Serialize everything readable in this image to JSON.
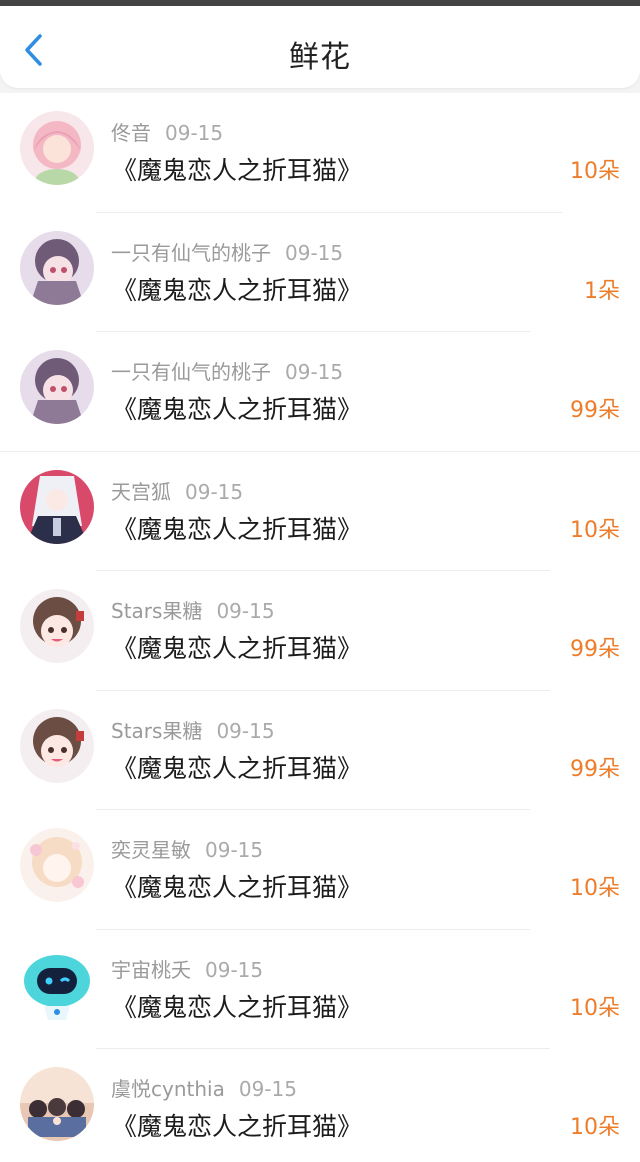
{
  "header": {
    "title": "鲜花"
  },
  "items": [
    {
      "name": "佟音",
      "date": "09-15",
      "book": "《魔鬼恋人之折耳猫》",
      "count": "10朵"
    },
    {
      "name": "一只有仙气的桃子",
      "date": "09-15",
      "book": "《魔鬼恋人之折耳猫》",
      "count": "1朵"
    },
    {
      "name": "一只有仙气的桃子",
      "date": "09-15",
      "book": "《魔鬼恋人之折耳猫》",
      "count": "99朵"
    },
    {
      "name": "天宫狐",
      "date": "09-15",
      "book": "《魔鬼恋人之折耳猫》",
      "count": "10朵"
    },
    {
      "name": "Stars果糖",
      "date": "09-15",
      "book": "《魔鬼恋人之折耳猫》",
      "count": "99朵"
    },
    {
      "name": "Stars果糖",
      "date": "09-15",
      "book": "《魔鬼恋人之折耳猫》",
      "count": "99朵"
    },
    {
      "name": "奕灵星敏",
      "date": "09-15",
      "book": "《魔鬼恋人之折耳猫》",
      "count": "10朵"
    },
    {
      "name": "宇宙桃夭",
      "date": "09-15",
      "book": "《魔鬼恋人之折耳猫》",
      "count": "10朵"
    },
    {
      "name": "虞悦cynthia",
      "date": "09-15",
      "book": "《魔鬼恋人之折耳猫》",
      "count": "10朵"
    }
  ],
  "colors": {
    "accent": "#ee7d2b",
    "back": "#2f8de4"
  }
}
